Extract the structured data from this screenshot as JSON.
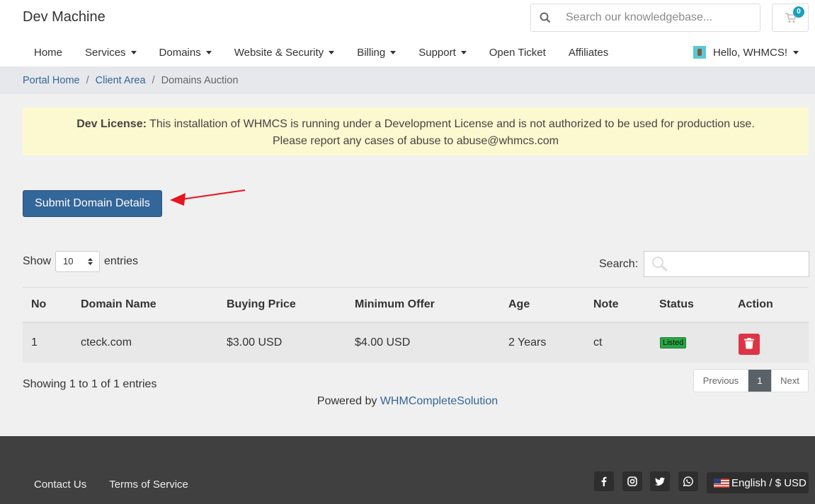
{
  "header": {
    "brand": "Dev Machine",
    "search_placeholder": "Search our knowledgebase...",
    "cart_count": "0",
    "nav": [
      {
        "label": "Home"
      },
      {
        "label": "Services"
      },
      {
        "label": "Domains"
      },
      {
        "label": "Website & Security"
      },
      {
        "label": "Billing"
      },
      {
        "label": "Support"
      },
      {
        "label": "Open Ticket"
      },
      {
        "label": "Affiliates"
      }
    ],
    "user_greeting": "Hello, WHMCS!"
  },
  "breadcrumb": {
    "items": [
      "Portal Home",
      "Client Area"
    ],
    "separator": "/",
    "active": "Domains Auction"
  },
  "alert": {
    "strong": "Dev License:",
    "line1": " This installation of WHMCS is running under a Development License and is not authorized to be used for production use.",
    "line2": "Please report any cases of abuse to abuse@whmcs.com"
  },
  "submit_button": "Submit Domain Details",
  "table_controls": {
    "show": "Show",
    "entries_value": "10",
    "entries": "entries",
    "search_label": "Search:"
  },
  "table": {
    "headers": [
      "No",
      "Domain Name",
      "Buying Price",
      "Minimum Offer",
      "Age",
      "Note",
      "Status",
      "Action"
    ],
    "rows": [
      {
        "no": "1",
        "domain": "cteck.com",
        "buying_price": "$3.00 USD",
        "minimum_offer": "$4.00 USD",
        "age": "2 Years",
        "note": "ct",
        "status": "Listed"
      }
    ]
  },
  "showing": "Showing 1 to 1 of 1 entries",
  "pagination": {
    "previous": "Previous",
    "current": "1",
    "next": "Next"
  },
  "powered": {
    "prefix": "Powered by ",
    "link": "WHMCompleteSolution"
  },
  "footer": {
    "links": [
      "Contact Us",
      "Terms of Service"
    ],
    "language": "English / $ USD"
  },
  "colors": {
    "primary": "#336699",
    "alert_bg": "#fcf8cf",
    "danger": "#dc3545",
    "success": "#28a745",
    "footer_bg": "#404040"
  }
}
